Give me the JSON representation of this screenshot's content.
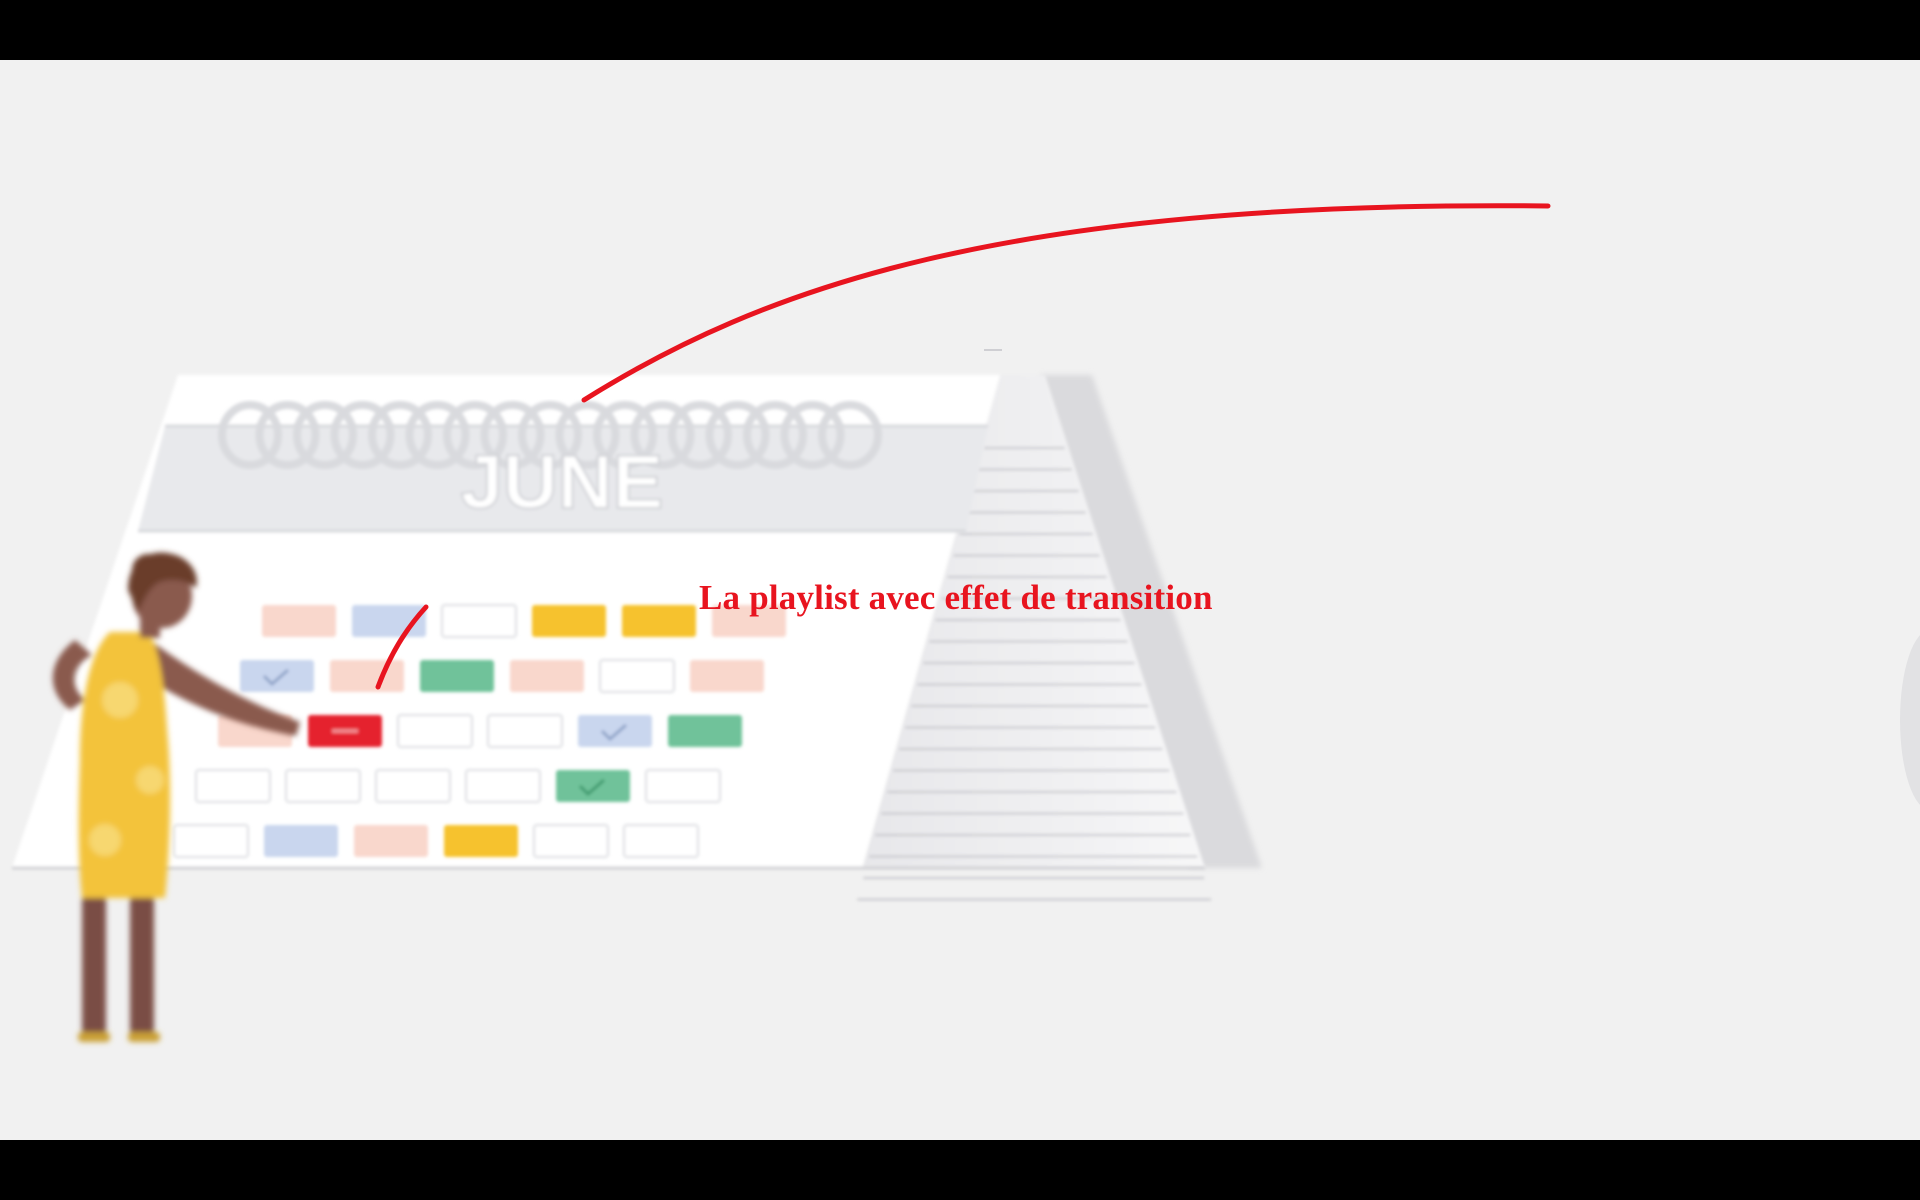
{
  "video": {
    "caption": "La playlist avec effet de transition",
    "caption_color": "#e8141f"
  },
  "calendar": {
    "month": "JUNE",
    "colors": {
      "peach": "#f9d7cc",
      "blue": "#c9d6ee",
      "yellow": "#f6c22f",
      "green": "#6fc29a",
      "red": "#e5222e",
      "white": "#ffffff"
    },
    "rows": [
      [
        "peach",
        "blue",
        "white",
        "yellow",
        "yellow",
        "peach"
      ],
      [
        "blue-check",
        "peach",
        "green",
        "peach",
        "white",
        "peach"
      ],
      [
        "peach",
        "red",
        "white",
        "white",
        "blue-check",
        "green"
      ],
      [
        "white",
        "white",
        "white",
        "white",
        "green-check",
        "white"
      ],
      [
        "white",
        "blue",
        "peach",
        "yellow",
        "white",
        "white"
      ]
    ]
  },
  "figure": {
    "dress_color": "#f3c33b",
    "skin_color": "#8a5a4e"
  }
}
